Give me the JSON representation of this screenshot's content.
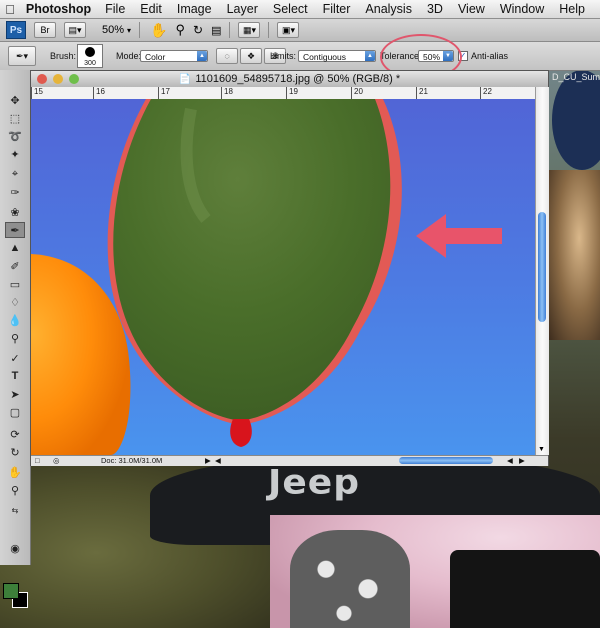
{
  "menubar": {
    "app_name": "Photoshop",
    "items": [
      "File",
      "Edit",
      "Image",
      "Layer",
      "Select",
      "Filter",
      "Analysis",
      "3D",
      "View",
      "Window",
      "Help"
    ]
  },
  "appbar": {
    "ps_badge": "Ps",
    "br_badge": "Br",
    "zoom": "50%"
  },
  "options": {
    "brush_label": "Brush:",
    "brush_size": "300",
    "mode_label": "Mode:",
    "mode_value": "Color",
    "limits_label": "Limits:",
    "limits_value": "Contiguous",
    "tolerance_label": "Tolerance:",
    "tolerance_value": "50%",
    "antialias_label": "Anti-alias",
    "antialias_checked": true
  },
  "document": {
    "title": "1101609_54895718.jpg @ 50% (RGB/8) *",
    "status_text": "Doc: 31.0M/31.0M",
    "ruler_labels": [
      "15",
      "16",
      "17",
      "18",
      "19",
      "20",
      "21",
      "22"
    ]
  },
  "desktop": {
    "background_label": "Jeep",
    "side_text": "D_CU_Sum"
  },
  "colors": {
    "foreground": "#3d7f3a",
    "background": "#000000",
    "balloon_green": "#4a6e2a",
    "annotation_red": "#e8546a"
  }
}
